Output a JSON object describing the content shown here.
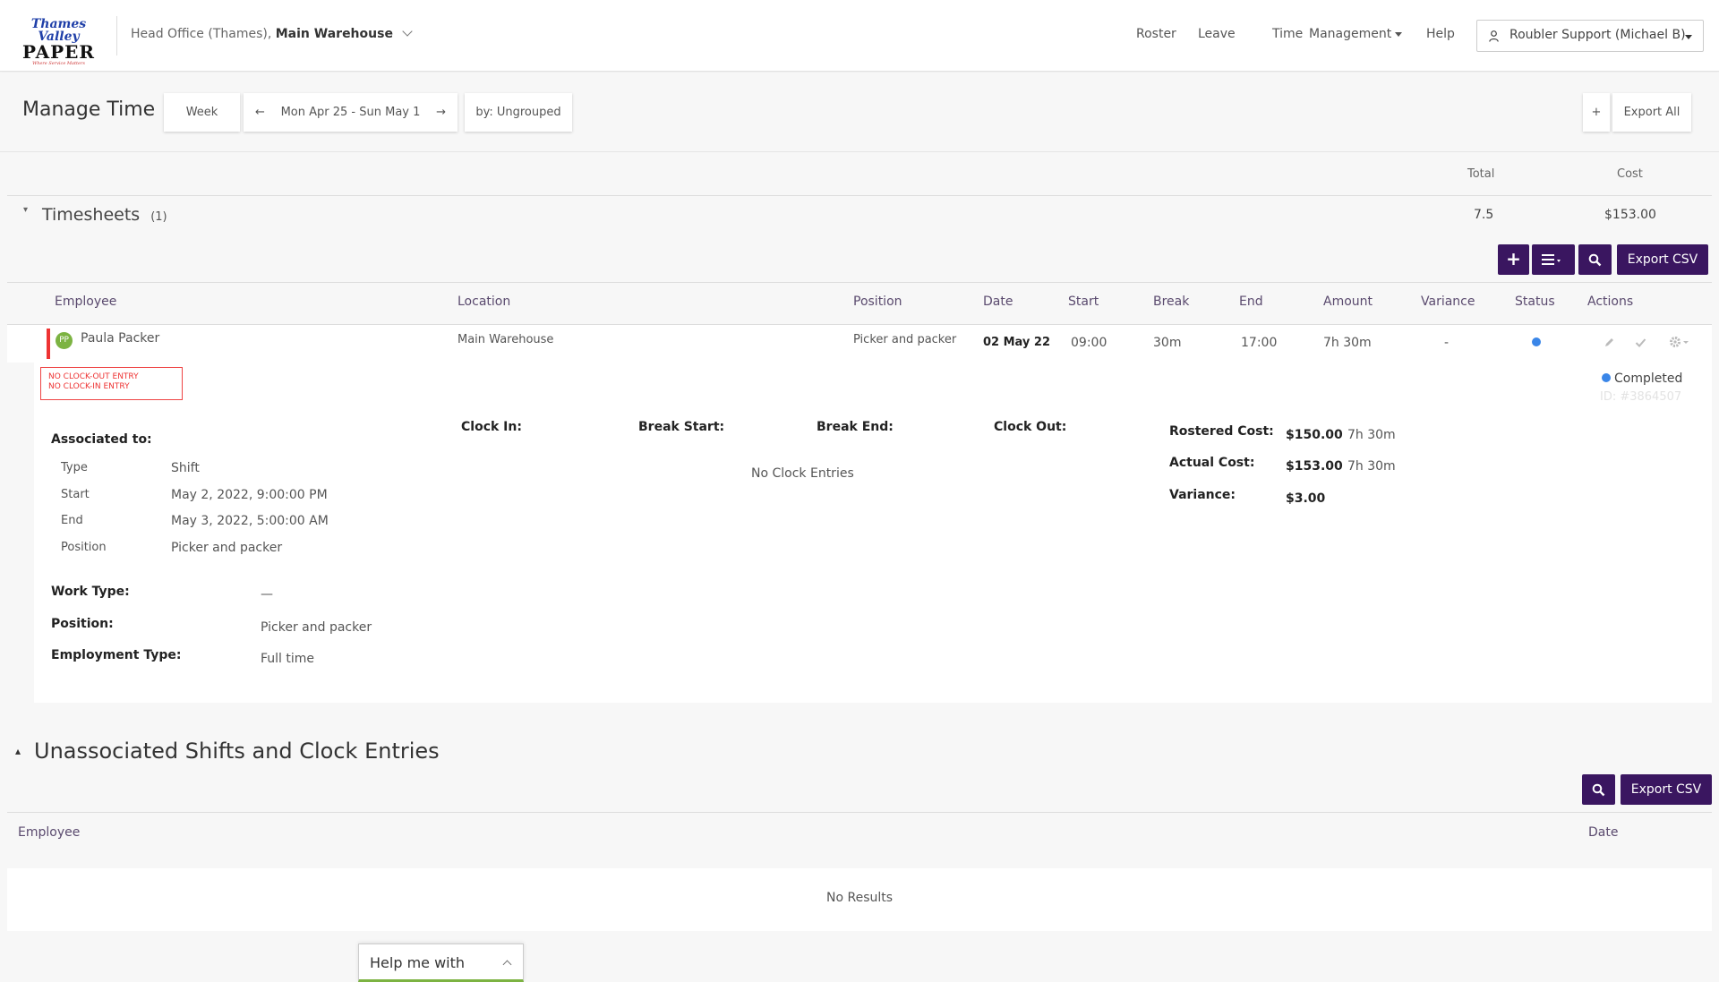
{
  "header": {
    "logo": {
      "line1": "Thames Valley",
      "line2": "PAPER",
      "tagline": "Where Service Matters"
    },
    "location_prefix": "Head Office (Thames),",
    "location_name": "Main Warehouse",
    "nav": [
      "Roster",
      "Leave",
      "Time",
      "Management",
      "Help"
    ],
    "user": "Roubler Support (Michael B)"
  },
  "toolbar": {
    "title": "Manage Time",
    "period": "Week",
    "date_range": "Mon Apr 25 - Sun May 1",
    "group_by": "by: Ungrouped",
    "add_label": "+",
    "export_all": "Export All"
  },
  "summary": {
    "total_header": "Total",
    "cost_header": "Cost",
    "section_title": "Timesheets",
    "count": "(1)",
    "total": "7.5",
    "cost": "$153.00"
  },
  "timesheet_actions": {
    "export_csv": "Export CSV"
  },
  "table": {
    "headers": [
      "Employee",
      "Location",
      "Position",
      "Date",
      "Start",
      "Break",
      "End",
      "Amount",
      "Variance",
      "Status",
      "Actions"
    ],
    "row": {
      "initials": "PP",
      "employee": "Paula Packer",
      "location": "Main Warehouse",
      "position": "Picker and packer",
      "date": "02 May 22",
      "start": "09:00",
      "break": "30m",
      "end": "17:00",
      "amount": "7h 30m",
      "variance": "-"
    }
  },
  "warnings": [
    "NO CLOCK-OUT ENTRY",
    "NO CLOCK-IN ENTRY"
  ],
  "detail": {
    "status": "Completed",
    "id": "ID: #3864507",
    "associated_title": "Associated to:",
    "assoc": [
      {
        "k": "Type",
        "v": "Shift"
      },
      {
        "k": "Start",
        "v": "May 2, 2022, 9:00:00 PM"
      },
      {
        "k": "End",
        "v": "May 3, 2022, 5:00:00 AM"
      },
      {
        "k": "Position",
        "v": "Picker and packer"
      }
    ],
    "work_type_label": "Work Type:",
    "work_type": "—",
    "position_label": "Position:",
    "position": "Picker and packer",
    "employment_label": "Employment Type:",
    "employment": "Full time",
    "clock_headers": [
      "Clock In:",
      "Break Start:",
      "Break End:",
      "Clock Out:"
    ],
    "no_clock": "No Clock Entries",
    "rostered_label": "Rostered Cost:",
    "rostered_cost": "$150.00",
    "rostered_time": "7h 30m",
    "actual_label": "Actual Cost:",
    "actual_cost": "$153.00",
    "actual_time": "7h 30m",
    "variance_label": "Variance:",
    "variance": "$3.00"
  },
  "unassociated": {
    "title": "Unassociated Shifts and Clock Entries",
    "export_csv": "Export CSV",
    "col_employee": "Employee",
    "col_date": "Date",
    "no_results": "No Results"
  },
  "help_widget": {
    "label": "Help me with"
  },
  "colors": {
    "brand": "#3a1660",
    "warning": "#e33",
    "status_blue": "#3a86e8",
    "avatar": "#7cb342"
  }
}
